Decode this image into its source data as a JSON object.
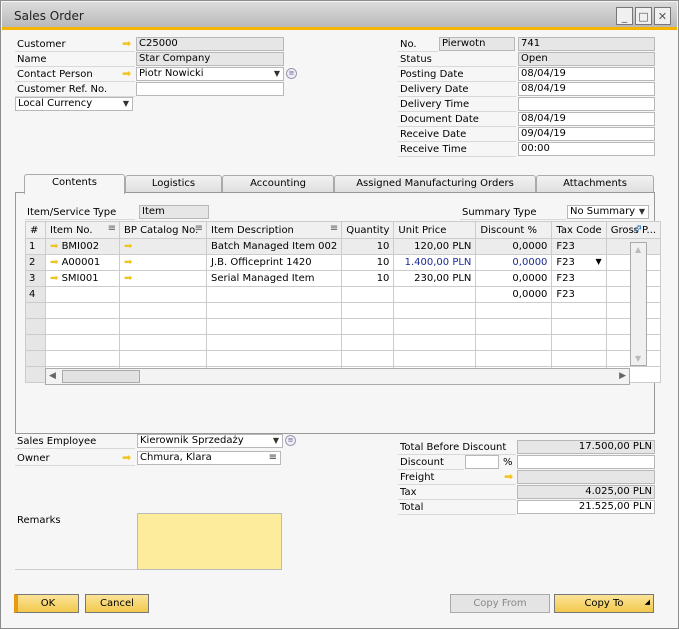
{
  "window": {
    "title": "Sales Order",
    "controls": [
      "minimize",
      "maximize",
      "close"
    ]
  },
  "header_left": {
    "customer": {
      "label": "Customer",
      "value": "C25000"
    },
    "name": {
      "label": "Name",
      "value": "Star Company"
    },
    "contact_person": {
      "label": "Contact Person",
      "value": "Piotr Nowicki"
    },
    "customer_ref": {
      "label": "Customer Ref. No.",
      "value": ""
    },
    "currency": {
      "value": "Local Currency"
    }
  },
  "header_right": {
    "no": {
      "label": "No.",
      "series": "Pierwotn",
      "value": "741"
    },
    "status": {
      "label": "Status",
      "value": "Open"
    },
    "posting_date": {
      "label": "Posting Date",
      "value": "08/04/19"
    },
    "delivery_date": {
      "label": "Delivery Date",
      "value": "08/04/19"
    },
    "delivery_time": {
      "label": "Delivery Time",
      "value": ""
    },
    "document_date": {
      "label": "Document Date",
      "value": "08/04/19"
    },
    "receive_date": {
      "label": "Receive Date",
      "value": "09/04/19"
    },
    "receive_time": {
      "label": "Receive Time",
      "value": "00:00"
    }
  },
  "tabs": [
    "Contents",
    "Logistics",
    "Accounting",
    "Assigned Manufacturing Orders",
    "Attachments"
  ],
  "contents": {
    "item_type": {
      "label": "Item/Service Type",
      "value": "Item"
    },
    "summary_type": {
      "label": "Summary Type",
      "value": "No Summary"
    },
    "columns": [
      "#",
      "Item No.",
      "BP Catalog No.",
      "Item Description",
      "Quantity",
      "Unit Price",
      "Discount %",
      "Tax Code",
      "Gross P..."
    ],
    "rows": [
      {
        "n": "1",
        "item": "BMI002",
        "desc": "Batch Managed Item 002",
        "qty": "10",
        "price": "120,00 PLN",
        "disc": "0,0000",
        "tax": "F23"
      },
      {
        "n": "2",
        "item": "A00001",
        "desc": "J.B. Officeprint 1420",
        "qty": "10",
        "price": "1.400,00 PLN",
        "disc": "0,0000",
        "tax": "F23"
      },
      {
        "n": "3",
        "item": "SMI001",
        "desc": "Serial Managed Item",
        "qty": "10",
        "price": "230,00 PLN",
        "disc": "0,0000",
        "tax": "F23"
      },
      {
        "n": "4",
        "item": "",
        "desc": "",
        "qty": "",
        "price": "",
        "disc": "0,0000",
        "tax": "F23"
      }
    ]
  },
  "footer_left": {
    "sales_employee": {
      "label": "Sales Employee",
      "value": "Kierownik Sprzedaży"
    },
    "owner": {
      "label": "Owner",
      "value": "Chmura, Klara"
    },
    "remarks": {
      "label": "Remarks",
      "value": ""
    }
  },
  "totals": {
    "total_before_discount": {
      "label": "Total Before Discount",
      "value": "17.500,00 PLN"
    },
    "discount": {
      "label": "Discount",
      "percent": "",
      "pct_sign": "%",
      "value": ""
    },
    "freight": {
      "label": "Freight",
      "value": ""
    },
    "tax": {
      "label": "Tax",
      "value": "4.025,00 PLN"
    },
    "total": {
      "label": "Total",
      "value": "21.525,00 PLN"
    }
  },
  "buttons": {
    "ok": "OK",
    "cancel": "Cancel",
    "copy_from": "Copy From",
    "copy_to": "Copy To"
  }
}
